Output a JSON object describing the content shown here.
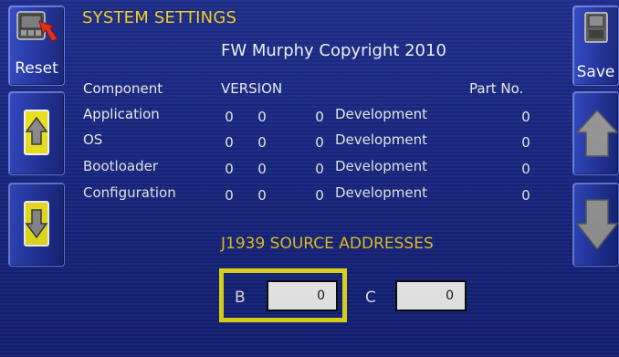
{
  "screen": {
    "title": "SYSTEM SETTINGS",
    "copyright": "FW Murphy Copyright 2010",
    "accent_color": "#f2cf1b",
    "highlight_color": "#f4ea1c"
  },
  "left_buttons": {
    "reset_label": "Reset",
    "reset_icon": "device-reset-icon",
    "up_icon": "arrow-up-icon",
    "down_icon": "arrow-down-icon"
  },
  "right_buttons": {
    "save_label": "Save",
    "save_icon": "save-device-icon",
    "up_icon": "arrow-up-icon",
    "down_icon": "arrow-down-icon"
  },
  "table": {
    "headers": {
      "component": "Component",
      "version": "VERSION",
      "part_no": "Part No."
    },
    "rows": [
      {
        "component": "Application",
        "major": "0",
        "minor": "0",
        "build": "0",
        "release": "Development",
        "part_no": "0"
      },
      {
        "component": "OS",
        "major": "0",
        "minor": "0",
        "build": "0",
        "release": "Development",
        "part_no": "0"
      },
      {
        "component": "Bootloader",
        "major": "0",
        "minor": "0",
        "build": "0",
        "release": "Development",
        "part_no": "0"
      },
      {
        "component": "Configuration",
        "major": "0",
        "minor": "0",
        "build": "0",
        "release": "Development",
        "part_no": "0"
      }
    ]
  },
  "j1939": {
    "title": "J1939 SOURCE ADDRESSES",
    "b_label": "B",
    "b_value": "0",
    "c_label": "C",
    "c_value": "0"
  }
}
